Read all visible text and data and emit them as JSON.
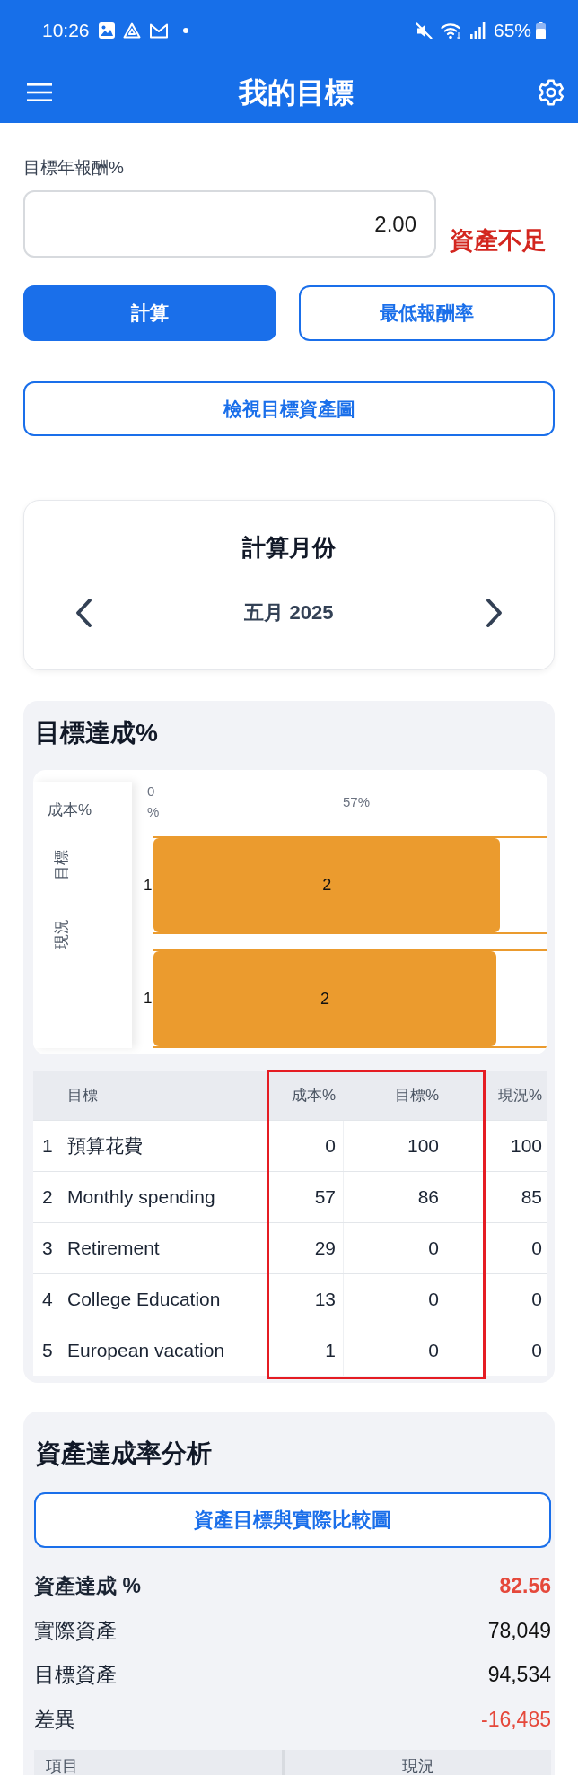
{
  "status_bar": {
    "time": "10:26",
    "battery": "65%"
  },
  "app_bar": {
    "title": "我的目標"
  },
  "return_field": {
    "label": "目標年報酬%",
    "value": "2.00",
    "warning": "資產不足"
  },
  "actions": [
    {
      "label": "計算",
      "kind": "primary"
    },
    {
      "label": "最低報酬率",
      "kind": "outline"
    }
  ],
  "view_chart_button": {
    "label": "檢視目標資產圖"
  },
  "month_picker": {
    "title": "計算月份",
    "month": "五月 2025"
  },
  "goal_section": {
    "title": "目標達成%",
    "chart": {
      "header": "成本%",
      "row_labels": [
        "目標",
        "現況"
      ],
      "axis_labels": [
        "0%",
        "57%"
      ],
      "bars": [
        {
          "start_label": "1",
          "label": "2"
        },
        {
          "start_label": "1",
          "label": "2"
        }
      ]
    },
    "table": {
      "columns": [
        {
          "label": "目標",
          "highlighted": false
        },
        {
          "label": "成本%",
          "highlighted": true
        },
        {
          "label": "目標%",
          "highlighted": true
        },
        {
          "label": "現況%",
          "highlighted": false
        }
      ],
      "rows": [
        {
          "index": "1",
          "cells": [
            "預算花費",
            "0",
            "100",
            "100"
          ]
        },
        {
          "index": "2",
          "cells": [
            "Monthly spending",
            "57",
            "86",
            "85"
          ]
        },
        {
          "index": "3",
          "cells": [
            "Retirement",
            "29",
            "0",
            "0"
          ]
        },
        {
          "index": "4",
          "cells": [
            "College Education",
            "13",
            "0",
            "0"
          ]
        },
        {
          "index": "5",
          "cells": [
            "European vacation",
            "1",
            "0",
            "0"
          ]
        }
      ]
    }
  },
  "asset_section": {
    "title": "資產達成率分析",
    "button": "資產目標與實際比較圖",
    "metrics": [
      {
        "label": "資產達成 %",
        "value": "82.56",
        "kind": "summary"
      },
      {
        "label": "實際資產",
        "value": "78,049",
        "kind": "plain"
      },
      {
        "label": "目標資產",
        "value": "94,534",
        "kind": "plain"
      },
      {
        "label": "差異",
        "value": "-16,485",
        "kind": "negative"
      }
    ],
    "table": {
      "columns": [
        "項目",
        "現況"
      ]
    }
  }
}
